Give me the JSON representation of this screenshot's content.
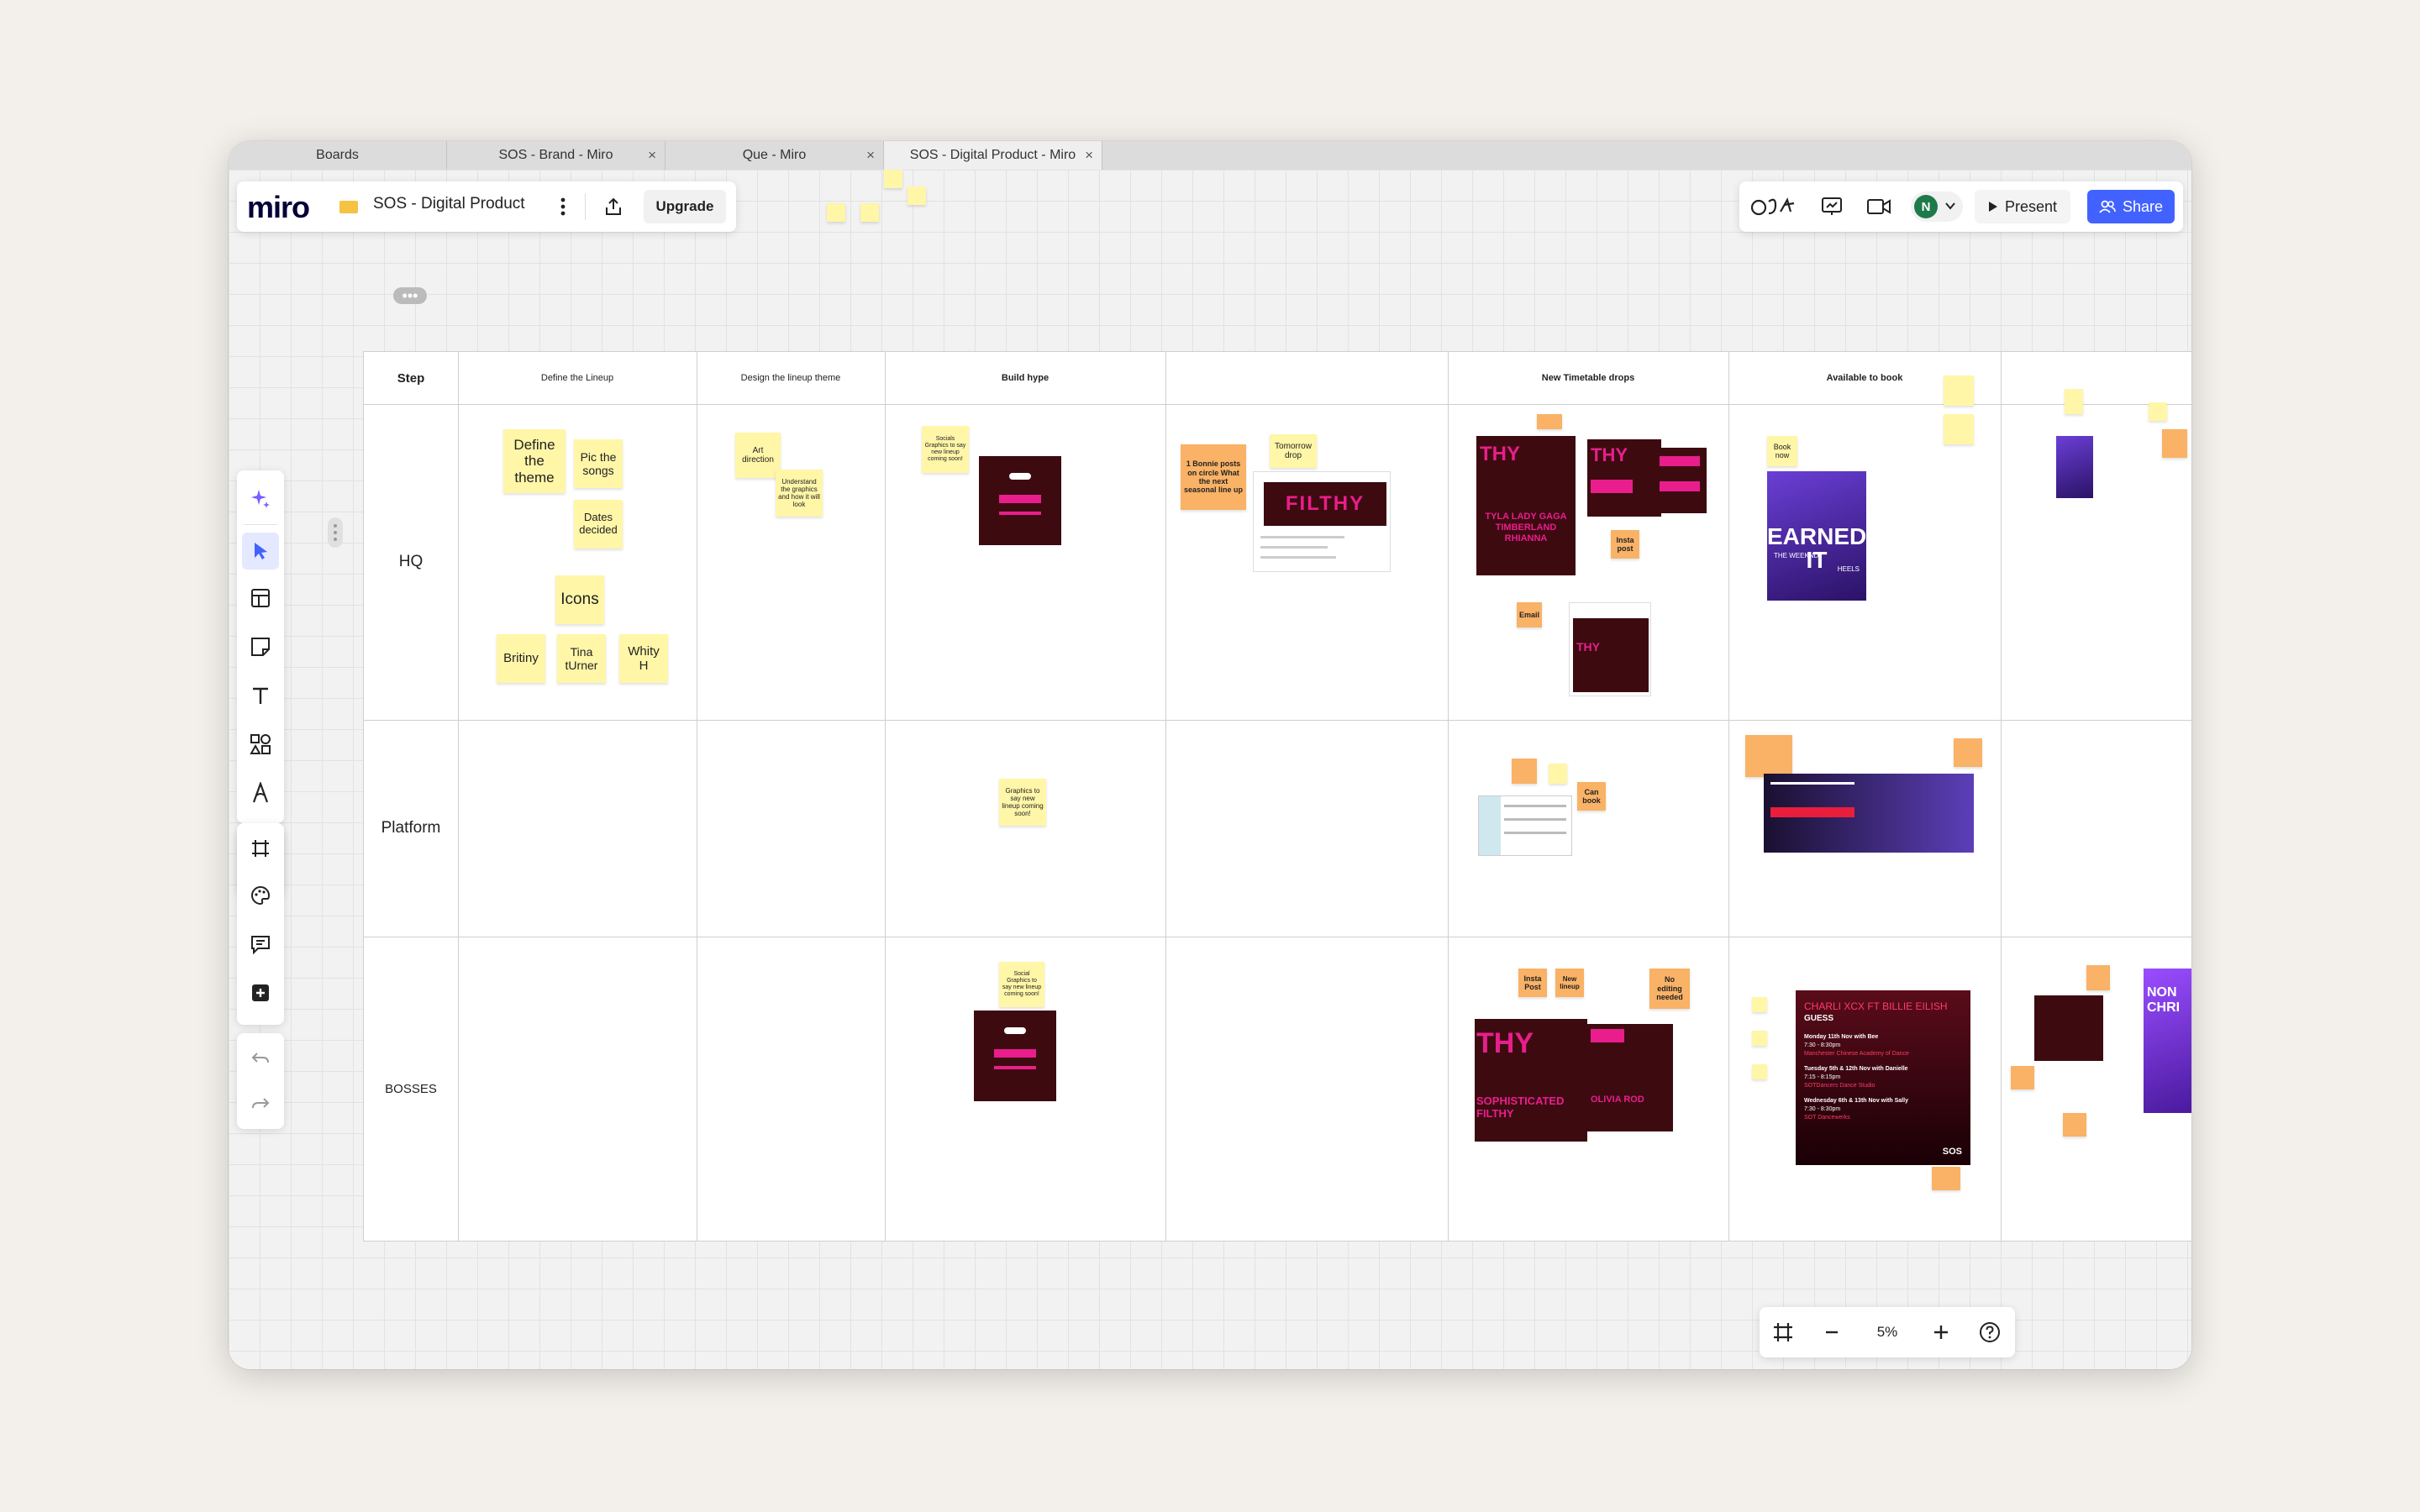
{
  "tabs": [
    {
      "label": "Boards"
    },
    {
      "label": "SOS - Brand - Miro"
    },
    {
      "label": "Que - Miro"
    },
    {
      "label": "SOS - Digital Product - Miro"
    }
  ],
  "header": {
    "logo": "miro",
    "board_name": "SOS - Digital Product",
    "upgrade_label": "Upgrade"
  },
  "right_toolbar": {
    "avatar_initial": "N",
    "present_label": "Present",
    "share_label": "Share"
  },
  "zoom": {
    "level": "5%"
  },
  "colors": {
    "accent": "#4262ff",
    "sticky_yellow": "#fff6a8",
    "sticky_orange": "#f9b266",
    "avatar": "#1f7a4a"
  },
  "table": {
    "step_header": "Step",
    "columns": [
      "Define the Lineup",
      "Design the lineup theme",
      "Build hype",
      "",
      "New Timetable drops",
      "Available to book",
      ""
    ],
    "rows": [
      "HQ",
      "Platform",
      "BOSSES"
    ]
  },
  "stickies": {
    "define_theme": "Define the theme",
    "pic_songs": "Pic the songs",
    "dates_decided": "Dates decided",
    "icons": "Icons",
    "britiny": "Britiny",
    "tina_turner": "Tina tUrner",
    "whity": "Whity H",
    "art_direction": "Art direction",
    "understand": "Understand the graphics and how it will look",
    "social_hq": "Socials Graphics to say new lineup coming soon!",
    "bonnie": "1 Bonnie posts on circle What the next seasonal line up",
    "tomorrow": "Tomorrow drop",
    "insta_post_hq": "Insta post",
    "email": "Email",
    "book_now": "Book now",
    "graphics_platform": "Graphics to say new lineup coming soon!",
    "can_book": "Can book",
    "social_bosses": "Social Graphics to say new lineup coming soon!",
    "insta_post_bosses": "Insta Post",
    "new_lineup": "New lineup",
    "no_editing": "No editing needed"
  },
  "images": {
    "filthy": "FILTHY",
    "tyla_lineup": "TYLA LADY GAGA TIMBERLAND RHIANNA",
    "earned": "EARNED IT",
    "weeknd": "THE WEEKND",
    "heels": "HEELS",
    "sophisticated": "SOPHISTICATED FILTHY",
    "olivia": "OLIVIA ROD",
    "charli_title": "CHARLI XCX FT BILLIE EILISH",
    "guess": "GUESS",
    "ev1_date": "Monday 11th Nov with Bee",
    "ev1_time": "7:30 - 8:30pm",
    "ev1_loc": "Manchester Chinese Academy of Dance",
    "ev2_date": "Tuesday 5th & 12th Nov with Danielle",
    "ev2_time": "7:15 - 8:15pm",
    "ev2_loc": "SOTDancers Dance Studio",
    "ev3_date": "Wednesday 6th & 13th Nov with Sally",
    "ev3_time": "7:30 - 8:30pm",
    "ev3_loc": "SOT Dancewerks",
    "non": "NON CHRI",
    "sos": "SOS"
  }
}
